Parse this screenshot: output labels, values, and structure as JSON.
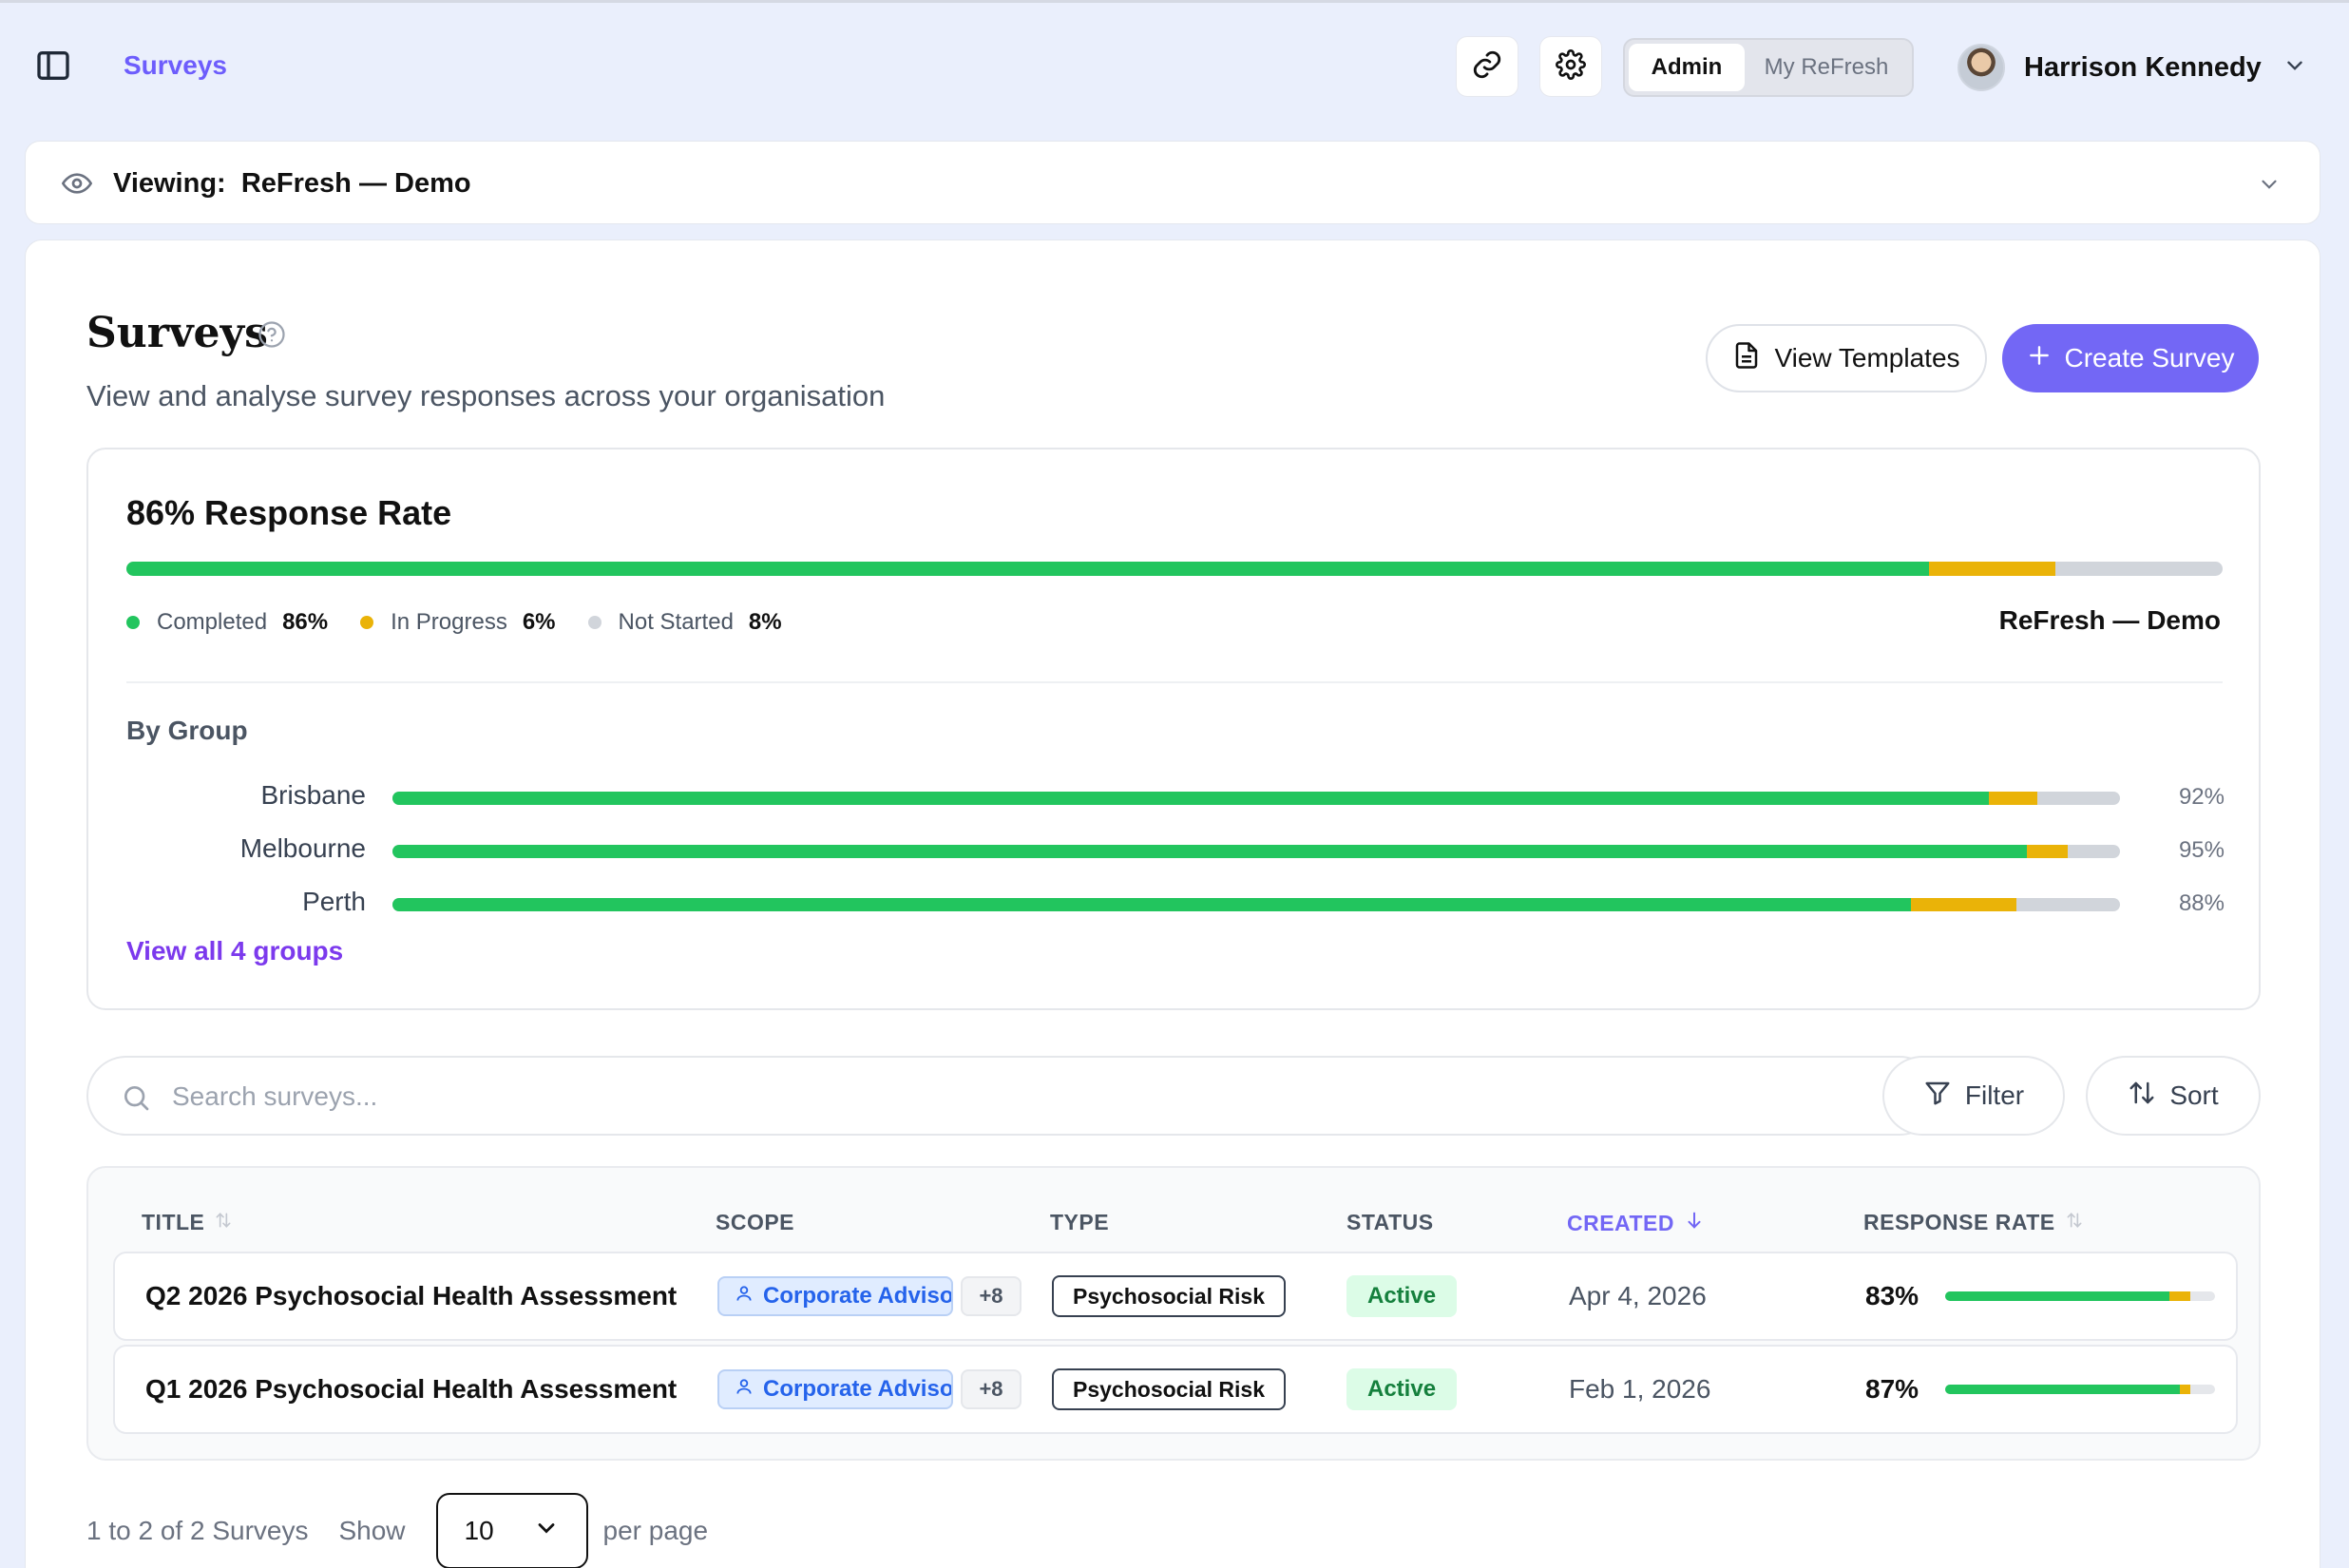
{
  "header": {
    "breadcrumb": "Surveys",
    "mode_tabs": [
      {
        "label": "Admin",
        "active": true
      },
      {
        "label": "My ReFresh",
        "active": false
      }
    ],
    "user": {
      "name": "Harrison Kennedy"
    }
  },
  "viewing": {
    "prefix": "Viewing:",
    "org": "ReFresh — Demo"
  },
  "page": {
    "title": "Surveys",
    "subtitle": "View and analyse survey responses across your organisation",
    "view_templates_label": "View Templates",
    "create_survey_label": "Create Survey"
  },
  "response": {
    "title": "86% Response Rate",
    "completed": 86,
    "in_progress": 6,
    "not_started": 8,
    "legend": [
      {
        "label": "Completed",
        "value": "86%",
        "color": "#22c55e"
      },
      {
        "label": "In Progress",
        "value": "6%",
        "color": "#eab308"
      },
      {
        "label": "Not Started",
        "value": "8%",
        "color": "#d1d5db"
      }
    ],
    "org": "ReFresh — Demo",
    "by_group_label": "By Group",
    "groups": [
      {
        "name": "Brisbane",
        "completed": 92.4,
        "in_progress": 2.8,
        "pct_label": "92%"
      },
      {
        "name": "Melbourne",
        "completed": 94.6,
        "in_progress": 2.4,
        "pct_label": "95%"
      },
      {
        "name": "Perth",
        "completed": 87.9,
        "in_progress": 6.1,
        "pct_label": "88%"
      }
    ],
    "view_all_label": "View all 4 groups"
  },
  "search": {
    "placeholder": "Search surveys..."
  },
  "toolbar": {
    "filter_label": "Filter",
    "sort_label": "Sort"
  },
  "table": {
    "columns": {
      "title": "TITLE",
      "scope": "SCOPE",
      "type": "TYPE",
      "status": "STATUS",
      "created": "CREATED",
      "response_rate": "RESPONSE RATE"
    },
    "rows": [
      {
        "title": "Q2 2026 Psychosocial Health Assessment",
        "scope": "Corporate Advisory",
        "scope_more": "+8",
        "type": "Psychosocial Risk",
        "status": "Active",
        "created": "Apr 4, 2026",
        "rate": "83%",
        "completed": 83,
        "in_progress": 8
      },
      {
        "title": "Q1 2026 Psychosocial Health Assessment",
        "scope": "Corporate Advisory",
        "scope_more": "+8",
        "type": "Psychosocial Risk",
        "status": "Active",
        "created": "Feb 1, 2026",
        "rate": "87%",
        "completed": 87,
        "in_progress": 4
      }
    ]
  },
  "pagination": {
    "summary": "1 to 2 of 2 Surveys",
    "show_label": "Show",
    "per_page_value": "10",
    "per_page_label": "per page"
  },
  "colors": {
    "accent": "#7367f5",
    "completed": "#22c55e",
    "in_progress": "#eab308",
    "not_started": "#d1d5db"
  }
}
